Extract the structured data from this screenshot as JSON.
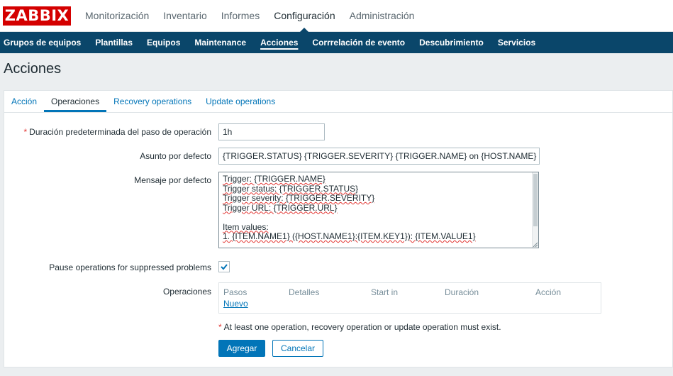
{
  "brand": {
    "logo_text": "ZABBIX",
    "logo_color": "#d40000"
  },
  "main_menu": [
    {
      "label": "Monitorización",
      "active": false
    },
    {
      "label": "Inventario",
      "active": false
    },
    {
      "label": "Informes",
      "active": false
    },
    {
      "label": "Configuración",
      "active": true
    },
    {
      "label": "Administración",
      "active": false
    }
  ],
  "sub_menu": [
    {
      "label": "Grupos de equipos",
      "active": false
    },
    {
      "label": "Plantillas",
      "active": false
    },
    {
      "label": "Equipos",
      "active": false
    },
    {
      "label": "Maintenance",
      "active": false
    },
    {
      "label": "Acciones",
      "active": true
    },
    {
      "label": "Corrrelación de evento",
      "active": false
    },
    {
      "label": "Descubrimiento",
      "active": false
    },
    {
      "label": "Servicios",
      "active": false
    }
  ],
  "page_title": "Acciones",
  "tabs": [
    {
      "label": "Acción",
      "active": false
    },
    {
      "label": "Operaciones",
      "active": true
    },
    {
      "label": "Recovery operations",
      "active": false
    },
    {
      "label": "Update operations",
      "active": false
    }
  ],
  "form": {
    "duration_label": "Duración predeterminada del paso de operación",
    "duration_required_mark": "*",
    "duration_value": "1h",
    "subject_label": "Asunto por defecto",
    "subject_value": "{TRIGGER.STATUS} {TRIGGER.SEVERITY} {TRIGGER.NAME} on {HOST.NAME}",
    "message_label": "Mensaje por defecto",
    "message_lines": [
      "Trigger: {TRIGGER.NAME}",
      "Trigger status: {TRIGGER.STATUS}",
      "Trigger severity: {TRIGGER.SEVERITY}",
      "Trigger URL: {TRIGGER.URL}",
      "",
      "Item values:",
      "1. {ITEM.NAME1} ({HOST.NAME1}:{ITEM.KEY1}): {ITEM.VALUE1}"
    ],
    "pause_label": "Pause operations for suppressed problems",
    "pause_checked": true,
    "operations_label": "Operaciones",
    "operations_headers": [
      "Pasos",
      "Detalles",
      "Start in",
      "Duración",
      "Acción"
    ],
    "operations_new_link": "Nuevo",
    "warning_mark": "*",
    "warning_text": "At least one operation, recovery operation or update operation must exist.",
    "add_button": "Agregar",
    "cancel_button": "Cancelar"
  },
  "colors": {
    "accent": "#0275b8",
    "subnav_bg": "#0a466a",
    "required": "#e33734"
  }
}
